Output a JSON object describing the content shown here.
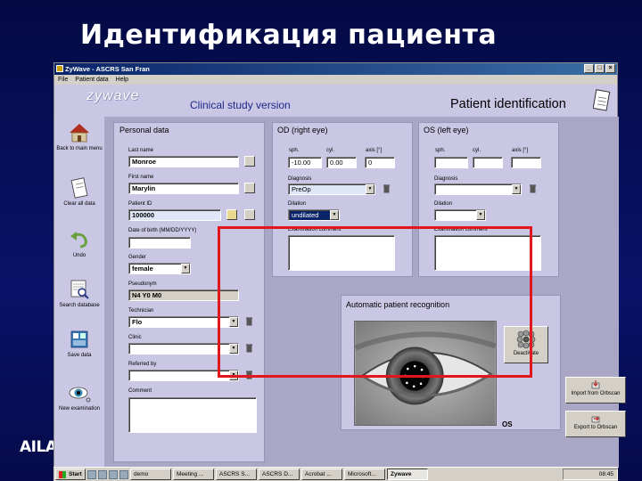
{
  "slide": {
    "title": "Идентификация пациента",
    "footer_logo": "AILAS",
    "footer_mark": "!"
  },
  "window": {
    "title": "ZyWave  -  ASCRS San Fran",
    "buttons": [
      "_",
      "□",
      "×"
    ]
  },
  "menu": [
    "File",
    "Patient data",
    "Help"
  ],
  "header": {
    "logo": "zywave",
    "subtitle": "Clinical study version",
    "section": "Patient identification"
  },
  "sidebar": [
    {
      "label": "Back to main menu",
      "icon": "house-icon"
    },
    {
      "label": "Clear all data",
      "icon": "clipboard-icon"
    },
    {
      "label": "Undo",
      "icon": "undo-arrow-icon"
    },
    {
      "label": "Search database",
      "icon": "search-database-icon"
    },
    {
      "label": "Save data",
      "icon": "save-data-icon"
    },
    {
      "label": "New examination",
      "icon": "eye-icon"
    }
  ],
  "personal": {
    "title": "Personal data",
    "last_name_label": "Last name",
    "last_name": "Monroe",
    "first_name_label": "First name",
    "first_name": "Marylin",
    "patient_id_label": "Patient ID",
    "patient_id": "100000",
    "dob_label": "Date of birth (MM/DD/YYYY)",
    "dob": "",
    "gender_label": "Gender",
    "gender": "female",
    "pseudonym_label": "Pseudonym",
    "pseudonym": "N4 Y0 M0",
    "technician_label": "Technician",
    "technician": "Flo",
    "clinic_label": "Clinic",
    "clinic": "",
    "referred_label": "Referred by",
    "referred": "",
    "comment_label": "Comment",
    "comment": ""
  },
  "od": {
    "title": "OD (right eye)",
    "sph_label": "sph.",
    "cyl_label": "cyl.",
    "axis_label": "axis [°]",
    "sph": "-10.00",
    "cyl": "0.00",
    "axis": "0",
    "diagnosis_label": "Diagnosis",
    "diagnosis": "PreOp",
    "dilation_label": "Dilation",
    "dilation": "undilated",
    "exam_label": "Examination comment",
    "exam": ""
  },
  "os": {
    "title": "OS (left eye)",
    "sph_label": "sph.",
    "cyl_label": "cyl.",
    "axis_label": "axis [°]",
    "sph": "",
    "cyl": "",
    "axis": "",
    "diagnosis_label": "Diagnosis",
    "diagnosis": "",
    "dilation_label": "Dilation",
    "dilation": "",
    "exam_label": "Examination comment",
    "exam": ""
  },
  "recognition": {
    "title": "Automatic patient recognition",
    "eye_label": "OS",
    "deactivate": "Deactivate",
    "import": "Import from Orbscan",
    "export": "Export to Orbscan"
  },
  "taskbar": {
    "start": "Start",
    "tasks": [
      "demo",
      "Meeting ...",
      "ASCRS S...",
      "ASCRS D...",
      "Acrobat ...",
      "Microsoft...",
      "Zywave"
    ],
    "clock": "08:45"
  },
  "colors": {
    "slide_bg": "#07105e",
    "panel": "#c9c7e3",
    "main_bg": "#a9a6c6",
    "highlight": "#e4161d",
    "titlebar": "#0a246a"
  }
}
